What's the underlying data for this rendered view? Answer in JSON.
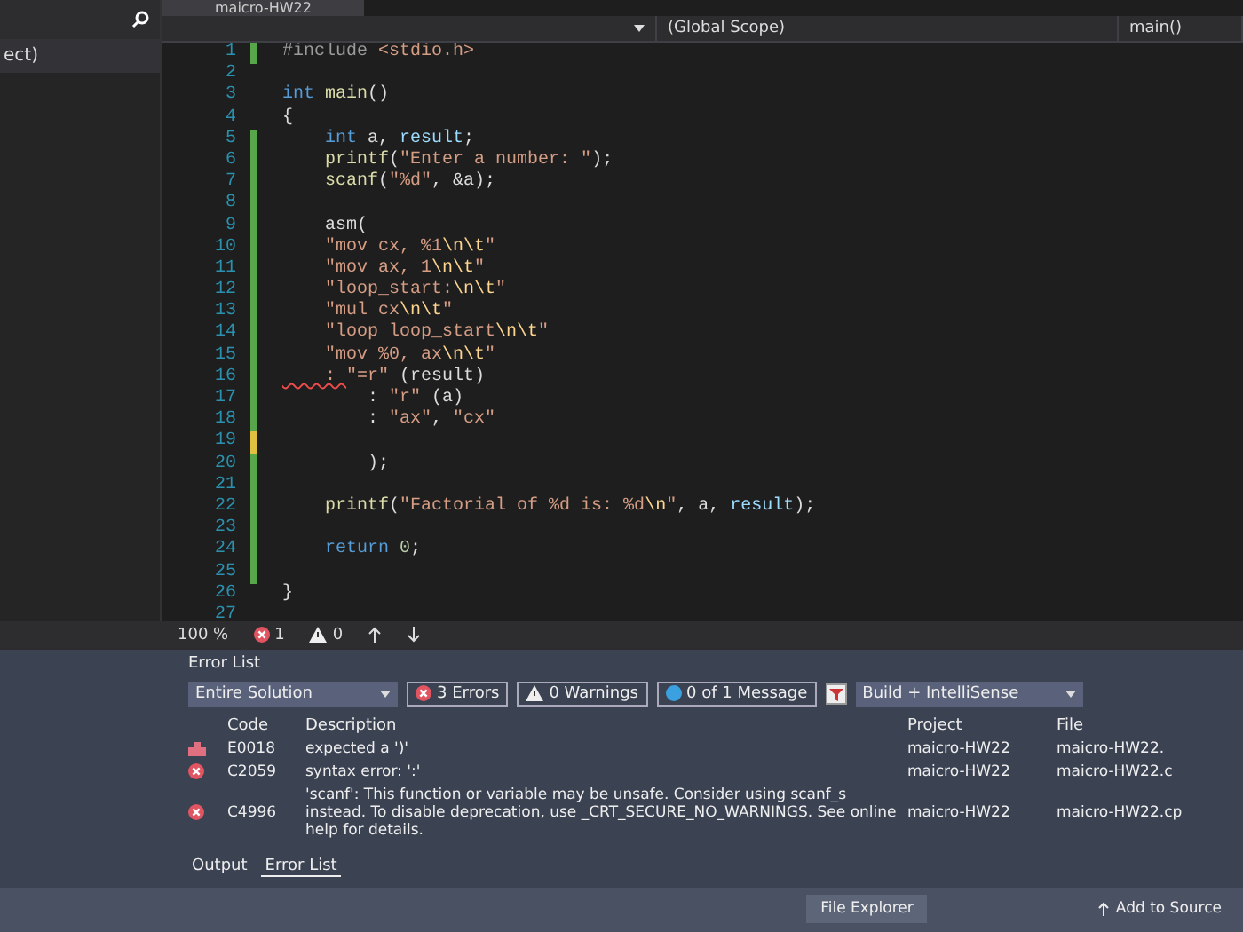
{
  "sidebar": {
    "item": "ect)"
  },
  "editor": {
    "title": "maicro-HW22",
    "scope": "(Global Scope)",
    "member": "main()",
    "lines": [
      {
        "number": "1",
        "changed": true,
        "saved": true,
        "tokens": [
          {
            "text": "#include ",
            "kind": "preproc"
          },
          {
            "text": "<stdio.h>",
            "kind": "string"
          }
        ]
      },
      {
        "number": "2",
        "changed": false
      },
      {
        "number": "3",
        "changed": false,
        "tokens": [
          {
            "text": "int",
            "kind": "keyword"
          },
          {
            "text": " main",
            "kind": "func"
          },
          {
            "text": "()",
            "kind": "plain"
          }
        ]
      },
      {
        "number": "4",
        "changed": false,
        "tokens": [
          {
            "text": "{",
            "kind": "plain"
          }
        ]
      },
      {
        "number": "5",
        "changed": true,
        "saved": true,
        "tokens": [
          {
            "text": "    int",
            "kind": "keyword"
          },
          {
            "text": " a, ",
            "kind": "plain"
          },
          {
            "text": "result",
            "kind": "var"
          },
          {
            "text": ";",
            "kind": "plain"
          }
        ]
      },
      {
        "number": "6",
        "changed": true,
        "saved": true,
        "tokens": [
          {
            "text": "    printf",
            "kind": "func"
          },
          {
            "text": "(",
            "kind": "plain"
          },
          {
            "text": "\"Enter a number: \"",
            "kind": "string"
          },
          {
            "text": ");",
            "kind": "plain"
          }
        ]
      },
      {
        "number": "7",
        "changed": true,
        "saved": true,
        "tokens": [
          {
            "text": "    scanf",
            "kind": "func"
          },
          {
            "text": "(",
            "kind": "plain"
          },
          {
            "text": "\"%d\"",
            "kind": "string"
          },
          {
            "text": ", &a);",
            "kind": "plain"
          }
        ]
      },
      {
        "number": "8",
        "changed": true,
        "saved": true
      },
      {
        "number": "9",
        "changed": true,
        "saved": true,
        "tokens": [
          {
            "text": "    asm(",
            "kind": "plain"
          }
        ]
      },
      {
        "number": "10",
        "changed": true,
        "saved": true,
        "tokens": [
          {
            "text": "    \"mov cx, %1",
            "kind": "string"
          },
          {
            "text": "\\n\\t",
            "kind": "escape"
          },
          {
            "text": "\"",
            "kind": "string"
          }
        ]
      },
      {
        "number": "11",
        "changed": true,
        "saved": true,
        "tokens": [
          {
            "text": "    \"mov ax, 1",
            "kind": "string"
          },
          {
            "text": "\\n\\t",
            "kind": "escape"
          },
          {
            "text": "\"",
            "kind": "string"
          }
        ]
      },
      {
        "number": "12",
        "changed": true,
        "saved": true,
        "tokens": [
          {
            "text": "    \"loop_start:",
            "kind": "string"
          },
          {
            "text": "\\n\\t",
            "kind": "escape"
          },
          {
            "text": "\"",
            "kind": "string"
          }
        ]
      },
      {
        "number": "13",
        "changed": true,
        "saved": true,
        "tokens": [
          {
            "text": "    \"mul cx",
            "kind": "string"
          },
          {
            "text": "\\n\\t",
            "kind": "escape"
          },
          {
            "text": "\"",
            "kind": "string"
          }
        ]
      },
      {
        "number": "14",
        "changed": true,
        "saved": true,
        "tokens": [
          {
            "text": "    \"loop loop_start",
            "kind": "string"
          },
          {
            "text": "\\n\\t",
            "kind": "escape"
          },
          {
            "text": "\"",
            "kind": "string"
          }
        ]
      },
      {
        "number": "15",
        "changed": true,
        "saved": true,
        "tokens": [
          {
            "text": "    \"mov %0, ax",
            "kind": "string"
          },
          {
            "text": "\\n\\t",
            "kind": "escape"
          },
          {
            "text": "\"",
            "kind": "string"
          }
        ]
      },
      {
        "number": "16",
        "changed": true,
        "saved": true,
        "tokens": [
          {
            "text": "    : ",
            "kind": "error"
          },
          {
            "text": "\"=r\"",
            "kind": "string"
          },
          {
            "text": " (result)",
            "kind": "plain"
          }
        ]
      },
      {
        "number": "17",
        "changed": true,
        "saved": true,
        "tokens": [
          {
            "text": "        : ",
            "kind": "plain"
          },
          {
            "text": "\"r\"",
            "kind": "string"
          },
          {
            "text": " (a)",
            "kind": "plain"
          }
        ]
      },
      {
        "number": "18",
        "changed": true,
        "saved": true,
        "tokens": [
          {
            "text": "        : ",
            "kind": "plain"
          },
          {
            "text": "\"ax\"",
            "kind": "string"
          },
          {
            "text": ", ",
            "kind": "plain"
          },
          {
            "text": "\"cx\"",
            "kind": "string"
          }
        ]
      },
      {
        "number": "19",
        "changed": true,
        "saved": false
      },
      {
        "number": "20",
        "changed": true,
        "saved": true,
        "tokens": [
          {
            "text": "        );",
            "kind": "plain"
          }
        ]
      },
      {
        "number": "21",
        "changed": true,
        "saved": true
      },
      {
        "number": "22",
        "changed": true,
        "saved": true,
        "tokens": [
          {
            "text": "    printf",
            "kind": "func"
          },
          {
            "text": "(",
            "kind": "plain"
          },
          {
            "text": "\"Factorial of %d is: %d",
            "kind": "string"
          },
          {
            "text": "\\n",
            "kind": "escape"
          },
          {
            "text": "\"",
            "kind": "string"
          },
          {
            "text": ", a, ",
            "kind": "plain"
          },
          {
            "text": "result",
            "kind": "var"
          },
          {
            "text": ");",
            "kind": "plain"
          }
        ]
      },
      {
        "number": "23",
        "changed": true,
        "saved": true
      },
      {
        "number": "24",
        "changed": true,
        "saved": true,
        "tokens": [
          {
            "text": "    return ",
            "kind": "keyword"
          },
          {
            "text": "0",
            "kind": "number"
          },
          {
            "text": ";",
            "kind": "plain"
          }
        ]
      },
      {
        "number": "25",
        "changed": true,
        "saved": true
      },
      {
        "number": "26",
        "changed": false,
        "tokens": [
          {
            "text": "}",
            "kind": "plain"
          }
        ]
      },
      {
        "number": "27",
        "changed": false
      }
    ]
  },
  "status": {
    "zoom": "100 %",
    "errors": "1",
    "warnings": "0"
  },
  "error_list": {
    "title": "Error List",
    "scope": "Entire Solution",
    "errors": "3 Errors",
    "warnings": "0 Warnings",
    "messages": "0 of 1 Message",
    "source": "Build + IntelliSense",
    "columns": [
      "Code",
      "Description",
      "Project",
      "File"
    ],
    "rows": [
      {
        "kind": "intellisense",
        "code": "E0018",
        "description": "expected a ')'",
        "project": "maicro-HW22",
        "file": "maicro-HW22."
      },
      {
        "kind": "error",
        "code": "C2059",
        "description": "syntax error: ':'",
        "project": "maicro-HW22",
        "file": "maicro-HW22.c"
      },
      {
        "kind": "error",
        "code": "C4996",
        "description": "'scanf': This function or variable may be unsafe. Consider using scanf_s instead. To disable deprecation, use _CRT_SECURE_NO_WARNINGS. See online help for details.",
        "project": "maicro-HW22",
        "file": "maicro-HW22.cp"
      }
    ]
  },
  "bottom_tabs": [
    {
      "label": "Output",
      "selected": false
    },
    {
      "label": "Error List",
      "selected": true
    }
  ],
  "tooltip": "File Explorer",
  "add_to_source": "Add to Source"
}
